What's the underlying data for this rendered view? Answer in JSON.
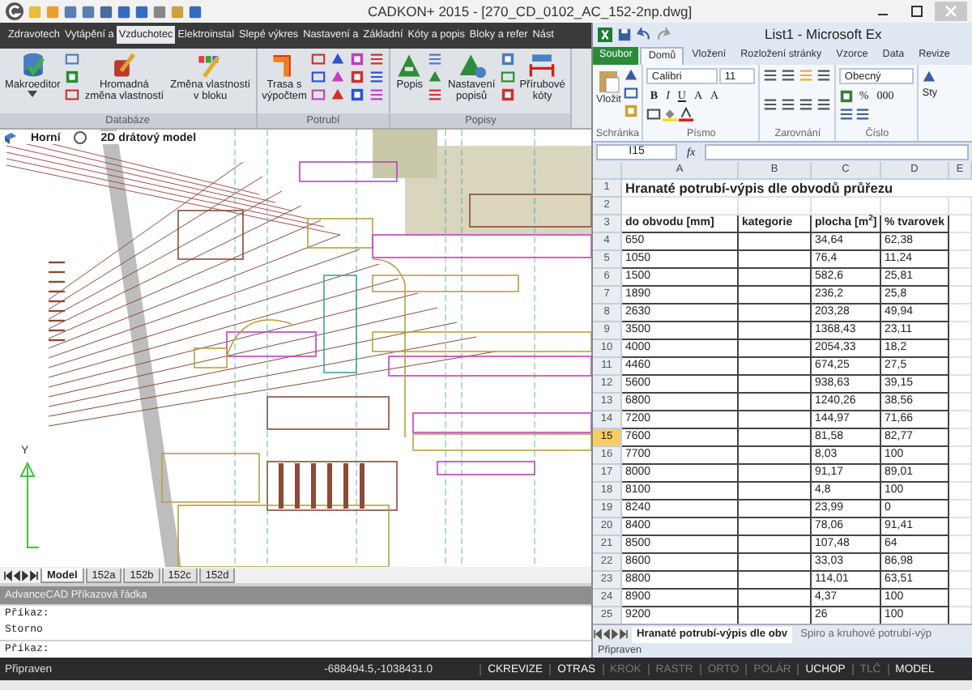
{
  "cad": {
    "title": "CADKON+ 2015 - [270_CD_0102_AC_152-2np.dwg]",
    "ribbon_tabs": [
      {
        "label": "Zdravotech",
        "selected": false
      },
      {
        "label": "Vytápění a",
        "selected": false
      },
      {
        "label": "Vzduchotec",
        "selected": true
      },
      {
        "label": "Elektroinstal",
        "selected": false
      },
      {
        "label": "Slepé výkres",
        "selected": false
      },
      {
        "label": "Nastavení a",
        "selected": false
      },
      {
        "label": "Základní",
        "selected": false
      },
      {
        "label": "Kóty a popis",
        "selected": false
      },
      {
        "label": "Bloky a refer",
        "selected": false
      },
      {
        "label": "Nást",
        "selected": false
      }
    ],
    "ribbon_groups": [
      {
        "label": "Databáze",
        "items": [
          {
            "kind": "large",
            "label": "Makroeditor",
            "dropdown": true
          },
          {
            "kind": "stack"
          },
          {
            "kind": "large",
            "label": "Hromadná\nzměna vlastností",
            "dropdown": false
          },
          {
            "kind": "large",
            "label": "Změna vlastností\nv bloku",
            "dropdown": false
          }
        ]
      },
      {
        "label": "Potrubí",
        "items": [
          {
            "kind": "large",
            "label": "Trasa s\nvýpočtem",
            "dropdown": false
          },
          {
            "kind": "grid"
          }
        ]
      },
      {
        "label": "Popisy",
        "items": [
          {
            "kind": "large",
            "label": "Popis",
            "dropdown": false
          },
          {
            "kind": "stack"
          },
          {
            "kind": "large",
            "label": "Nastavení\npopisů",
            "dropdown": false
          },
          {
            "kind": "stack"
          },
          {
            "kind": "large",
            "label": "Přírubové\nkóty",
            "dropdown": false
          }
        ]
      }
    ],
    "viewport": {
      "view": "Horní",
      "visual_style": "2D drátový model",
      "axis_label": "Y"
    },
    "layout_tabs": [
      {
        "label": "Model",
        "selected": true
      },
      {
        "label": "152a",
        "selected": false
      },
      {
        "label": "152b",
        "selected": false
      },
      {
        "label": "152c",
        "selected": false
      },
      {
        "label": "152d",
        "selected": false
      }
    ],
    "command_line": {
      "title": "AdvanceCAD Příkazová řádka",
      "history": [
        "Příkaz:",
        "Storno"
      ],
      "prompt": "Příkaz:"
    },
    "status_bar": {
      "message": "Připraven",
      "coordinates": "-688494.5,-1038431.0",
      "toggles": [
        {
          "label": "CKREVIZE",
          "on": true
        },
        {
          "label": "OTRAS",
          "on": true
        },
        {
          "label": "KROK",
          "on": false
        },
        {
          "label": "RASTR",
          "on": false
        },
        {
          "label": "ORTO",
          "on": false
        },
        {
          "label": "POLÁR",
          "on": false
        },
        {
          "label": "UCHOP",
          "on": true
        },
        {
          "label": "TLČ",
          "on": false
        },
        {
          "label": "MODEL",
          "on": true
        }
      ]
    }
  },
  "excel": {
    "title": "List1 - Microsoft Ex",
    "tabs": [
      {
        "label": "Soubor",
        "kind": "file",
        "selected": false
      },
      {
        "label": "Domů",
        "kind": "tab",
        "selected": true
      },
      {
        "label": "Vložení",
        "kind": "tab",
        "selected": false
      },
      {
        "label": "Rozložení stránky",
        "kind": "tab",
        "selected": false
      },
      {
        "label": "Vzorce",
        "kind": "tab",
        "selected": false
      },
      {
        "label": "Data",
        "kind": "tab",
        "selected": false
      },
      {
        "label": "Revize",
        "kind": "tab",
        "selected": false
      }
    ],
    "ribbon": {
      "paste_label": "Vložit",
      "font_name": "Calibri",
      "font_size": "11",
      "font_styles": [
        "B",
        "I",
        "U"
      ],
      "size_buttons": [
        "A",
        "A"
      ],
      "number_format": "Obecný",
      "number_buttons": [
        "%",
        "000"
      ],
      "styles_label": "Sty",
      "groups": [
        "Schránka",
        "Písmo",
        "Zarovnání",
        "Číslo"
      ]
    },
    "formula_bar": {
      "name_box": "I15",
      "function_label": "fx"
    },
    "columns": [
      "A",
      "B",
      "C",
      "D",
      "E"
    ],
    "rows": [
      {
        "number": "1",
        "kind": "title",
        "selected": false,
        "cells": {
          "A": "Hranaté potrubí-výpis dle obvodů průřezu"
        }
      },
      {
        "number": "2",
        "kind": "empty",
        "selected": false
      },
      {
        "number": "3",
        "kind": "header",
        "selected": false,
        "cells": {
          "A": "do obvodu [mm]",
          "B": "kategorie",
          "C": "plocha [m$^{2}$]",
          "D": "% tvarovek"
        }
      },
      {
        "number": "4",
        "kind": "data",
        "selected": false,
        "cells": {
          "A": "650",
          "C": "34,64",
          "D": "62,38"
        }
      },
      {
        "number": "5",
        "kind": "data",
        "selected": false,
        "cells": {
          "A": "1050",
          "C": "76,4",
          "D": "11,24"
        }
      },
      {
        "number": "6",
        "kind": "data",
        "selected": false,
        "cells": {
          "A": "1500",
          "C": "582,6",
          "D": "25,81"
        }
      },
      {
        "number": "7",
        "kind": "data",
        "selected": false,
        "cells": {
          "A": "1890",
          "C": "236,2",
          "D": "25,8"
        }
      },
      {
        "number": "8",
        "kind": "data",
        "selected": false,
        "cells": {
          "A": "2630",
          "C": "203,28",
          "D": "49,94"
        }
      },
      {
        "number": "9",
        "kind": "data",
        "selected": false,
        "cells": {
          "A": "3500",
          "C": "1368,43",
          "D": "23,11"
        }
      },
      {
        "number": "10",
        "kind": "data",
        "selected": false,
        "cells": {
          "A": "4000",
          "C": "2054,33",
          "D": "18,2"
        }
      },
      {
        "number": "11",
        "kind": "data",
        "selected": false,
        "cells": {
          "A": "4460",
          "C": "674,25",
          "D": "27,5"
        }
      },
      {
        "number": "12",
        "kind": "data",
        "selected": false,
        "cells": {
          "A": "5600",
          "C": "938,63",
          "D": "39,15"
        }
      },
      {
        "number": "13",
        "kind": "data",
        "selected": false,
        "cells": {
          "A": "6800",
          "C": "1240,26",
          "D": "38,56"
        }
      },
      {
        "number": "14",
        "kind": "data",
        "selected": false,
        "cells": {
          "A": "7200",
          "C": "144,97",
          "D": "71,66"
        }
      },
      {
        "number": "15",
        "kind": "data",
        "selected": true,
        "cells": {
          "A": "7600",
          "C": "81,58",
          "D": "82,77"
        }
      },
      {
        "number": "16",
        "kind": "data",
        "selected": false,
        "cells": {
          "A": "7700",
          "C": "8,03",
          "D": "100"
        }
      },
      {
        "number": "17",
        "kind": "data",
        "selected": false,
        "cells": {
          "A": "8000",
          "C": "91,17",
          "D": "89,01"
        }
      },
      {
        "number": "18",
        "kind": "data",
        "selected": false,
        "cells": {
          "A": "8100",
          "C": "4,8",
          "D": "100"
        }
      },
      {
        "number": "19",
        "kind": "data",
        "selected": false,
        "cells": {
          "A": "8240",
          "C": "23,99",
          "D": "0"
        }
      },
      {
        "number": "20",
        "kind": "data",
        "selected": false,
        "cells": {
          "A": "8400",
          "C": "78,06",
          "D": "91,41"
        }
      },
      {
        "number": "21",
        "kind": "data",
        "selected": false,
        "cells": {
          "A": "8500",
          "C": "107,48",
          "D": "64"
        }
      },
      {
        "number": "22",
        "kind": "data",
        "selected": false,
        "cells": {
          "A": "8600",
          "C": "33,03",
          "D": "86,98"
        }
      },
      {
        "number": "23",
        "kind": "data",
        "selected": false,
        "cells": {
          "A": "8800",
          "C": "114,01",
          "D": "63,51"
        }
      },
      {
        "number": "24",
        "kind": "data",
        "selected": false,
        "cells": {
          "A": "8900",
          "C": "4,37",
          "D": "100"
        }
      },
      {
        "number": "25",
        "kind": "data",
        "selected": false,
        "cells": {
          "A": "9200",
          "C": "26",
          "D": "100"
        }
      }
    ],
    "sheet_tabs": [
      {
        "label": "Hranaté potrubí-výpis dle obv",
        "selected": true
      },
      {
        "label": "Spiro a kruhové potrubí-výp",
        "selected": false
      }
    ],
    "status": "Připraven"
  }
}
